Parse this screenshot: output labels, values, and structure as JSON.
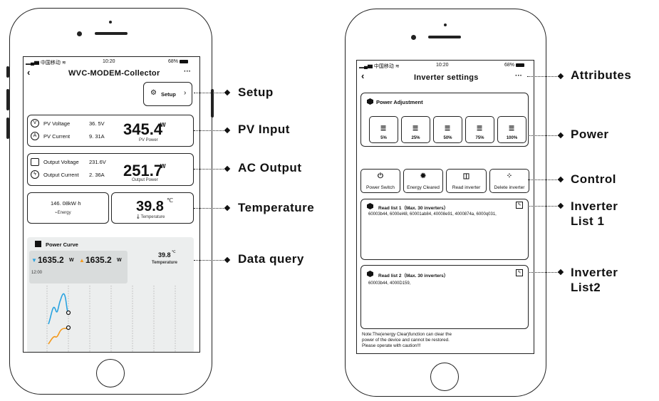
{
  "left_phone": {
    "status": {
      "carrier": "中国移动",
      "time": "10:20",
      "battery": "68%"
    },
    "title": "WVC-MODEM-Collector",
    "setup_label": "Setup",
    "pv": {
      "voltage_label": "PV Voltage",
      "voltage_value": "36. 5V",
      "current_label": "PV Current",
      "current_value": "9. 31A",
      "power_value": "345.4",
      "power_unit": "W",
      "power_caption": "PV Power"
    },
    "ac": {
      "voltage_label": "Output Voltage",
      "voltage_value": "231.6V",
      "current_label": "Output Current",
      "current_value": "2. 36A",
      "power_value": "251.7",
      "power_unit": "W",
      "power_caption": "Output Power"
    },
    "energy": {
      "value": "146. 08kW·h",
      "caption": "Energy"
    },
    "temp": {
      "value": "39.8",
      "unit": "℃",
      "caption": "Temperature"
    },
    "curve": {
      "title": "Power Curve",
      "value1": "1635.2",
      "unit1": "W",
      "value2": "1635.2",
      "unit2": "W",
      "time": "12:00",
      "temp_value": "39.8",
      "temp_unit": "℃",
      "temp_caption": "Temperature"
    }
  },
  "right_phone": {
    "status": {
      "carrier": "中国移动",
      "time": "10:20",
      "battery": "68%"
    },
    "title": "Inverter settings",
    "power_adjustment": {
      "title": "Power Adjustment",
      "options": [
        "5%",
        "25%",
        "50%",
        "75%",
        "100%"
      ]
    },
    "controls": [
      "Power Switch",
      "Energy Cleared",
      "Read inverter",
      "Delete inverter"
    ],
    "list1": {
      "title": "Read list 1（Max. 30 inverters）",
      "items": "60003b44, 6000el48, 60001ab84, 40008e91, 4000874a, 6000q031,"
    },
    "list2": {
      "title": "Read list 2（Max. 30 inverters）",
      "items": "60003b44, 4000D159,"
    },
    "note": [
      "Note:The(energy Clear)function can clear the",
      "power of the device and cannot be restored.",
      "Please operate with caution!!!"
    ]
  },
  "callouts": {
    "setup": "Setup",
    "pv_input": "PV Input",
    "ac_output": "AC Output",
    "temperature": "Temperature",
    "data_query": "Data query",
    "attributes": "Attributes",
    "power": "Power",
    "control": "Control",
    "list1_line1": "Inverter",
    "list1_line2": "List 1",
    "list2_line1": "Inverter",
    "list2_line2": "List2"
  }
}
